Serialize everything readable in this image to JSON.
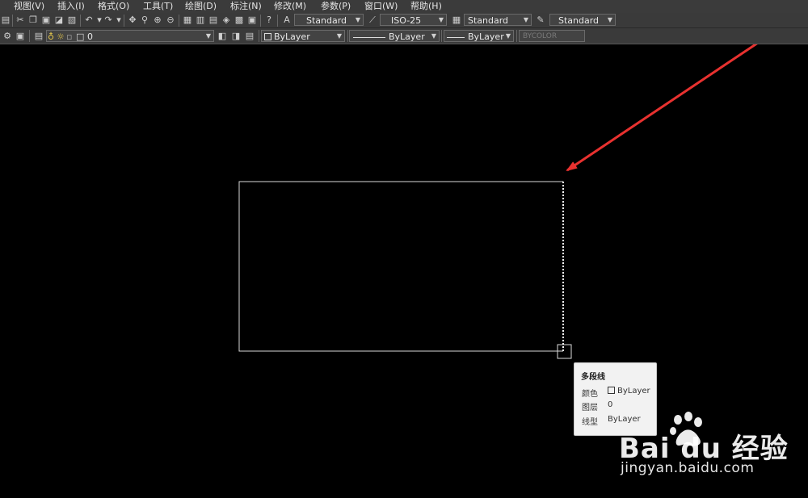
{
  "menubar": {
    "items": [
      "视图(V)",
      "插入(I)",
      "格式(O)",
      "工具(T)",
      "绘图(D)",
      "标注(N)",
      "修改(M)",
      "参数(P)",
      "窗口(W)",
      "帮助(H)"
    ]
  },
  "toolbar1": {
    "text_style": "Standard",
    "dim_style": "ISO-25",
    "table_style": "Standard",
    "multileader_style": "Standard"
  },
  "toolbar2": {
    "layer": "0",
    "color": "ByLayer",
    "linetype": "ByLayer",
    "lineweight": "ByLayer",
    "plot_style": "BYCOLOR"
  },
  "tooltip": {
    "title": "多段线",
    "color_label": "颜色",
    "color_value": "ByLayer",
    "layer_label": "图层",
    "layer_value": "0",
    "linetype_label": "线型",
    "linetype_value": "ByLayer"
  },
  "watermark": {
    "logo": "Bai du 经验",
    "url": "jingyan.baidu.com"
  },
  "colors": {
    "canvas": "#000000",
    "arrow": "#e8312f",
    "geometry": "#ffffff",
    "menubar": "#3b3b3b"
  },
  "icons": [
    "new-icon",
    "cut-icon",
    "copy-icon",
    "paste-icon",
    "match-properties-icon",
    "undo-icon",
    "redo-icon",
    "pan-icon",
    "zoom-realtime-icon",
    "zoom-window-icon",
    "zoom-previous-icon",
    "properties-icon",
    "design-center-icon",
    "tool-palettes-icon",
    "sheet-set-icon",
    "markup-icon",
    "calculator-icon",
    "help-icon",
    "text-style-icon",
    "dim-style-icon",
    "table-style-icon",
    "multileader-style-icon",
    "layer-manager-icon",
    "layer-state-icon",
    "make-current-icon",
    "layer-previous-icon"
  ]
}
